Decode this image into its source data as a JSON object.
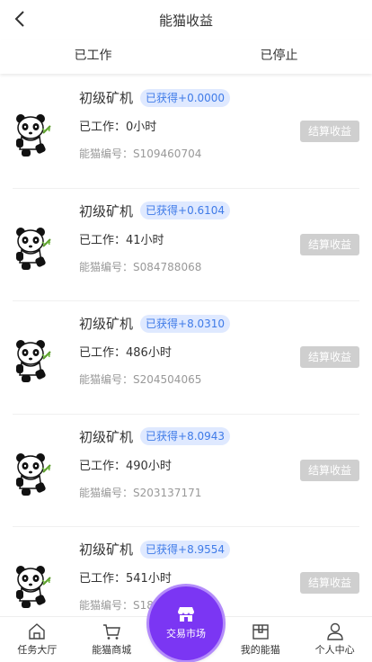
{
  "header": {
    "title": "能猫收益"
  },
  "tabs": [
    {
      "label": "已工作"
    },
    {
      "label": "已停止"
    }
  ],
  "labels": {
    "worked_prefix": "已工作：",
    "serial_prefix": "能猫编号：",
    "settle": "结算收益"
  },
  "cards": [
    {
      "name": "初级矿机",
      "earned": "已获得+0.0000",
      "worked": "0小时",
      "serial": "S109460704"
    },
    {
      "name": "初级矿机",
      "earned": "已获得+0.6104",
      "worked": "41小时",
      "serial": "S084788068"
    },
    {
      "name": "初级矿机",
      "earned": "已获得+8.0310",
      "worked": "486小时",
      "serial": "S204504065"
    },
    {
      "name": "初级矿机",
      "earned": "已获得+8.0943",
      "worked": "490小时",
      "serial": "S203137171"
    },
    {
      "name": "初级矿机",
      "earned": "已获得+8.9554",
      "worked": "541小时",
      "serial": "S18"
    }
  ],
  "bottom_nav": {
    "items": [
      {
        "label": "任务大厅",
        "icon": "home-icon"
      },
      {
        "label": "能猫商城",
        "icon": "cart-icon"
      },
      {
        "label": "我的能猫",
        "icon": "box-icon"
      },
      {
        "label": "个人中心",
        "icon": "user-icon"
      }
    ],
    "center": {
      "label": "交易市场",
      "icon": "shop-icon"
    }
  },
  "colors": {
    "accent": "#7b36f3",
    "badge_bg": "#dfe9ff",
    "badge_text": "#3f7be8",
    "settle_bg": "#cfcfcf"
  }
}
